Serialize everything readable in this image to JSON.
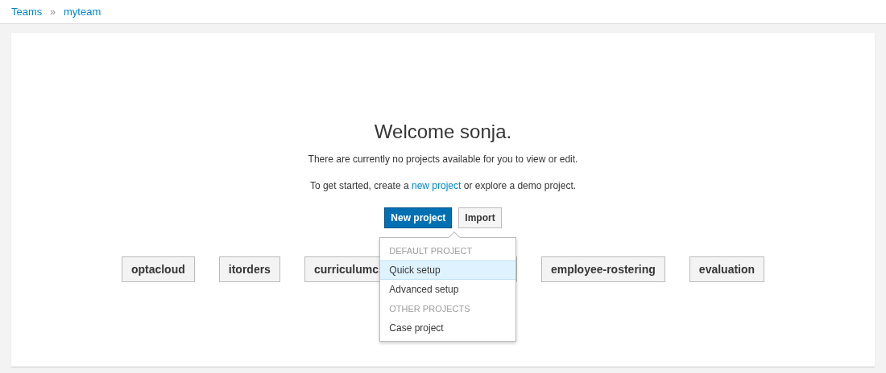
{
  "breadcrumb": [
    {
      "label": "Teams"
    },
    {
      "label": "myteam"
    }
  ],
  "breadcrumb_separator": "»",
  "welcome": {
    "title": "Welcome sonja.",
    "message": "There are currently no projects available for you to view or edit.",
    "hint_before": "To get started, create a",
    "hint_link": "new project",
    "hint_after": "or explore a demo project."
  },
  "buttons": [
    {
      "label": "New project",
      "kind": "primary"
    },
    {
      "label": "Import",
      "kind": "default"
    }
  ],
  "menu": [
    {
      "kind": "header",
      "label": "DEFAULT PROJECT"
    },
    {
      "kind": "item",
      "label": "Quick setup",
      "selected": true
    },
    {
      "kind": "item",
      "label": "Advanced setup",
      "selected": false
    },
    {
      "kind": "header",
      "label": "OTHER PROJECTS"
    },
    {
      "kind": "item",
      "label": "Case project",
      "selected": false
    }
  ],
  "demo_projects": [
    {
      "label": "optacloud",
      "covered": false
    },
    {
      "label": "itorders",
      "covered": false
    },
    {
      "label": "curriculumc",
      "covered": true
    },
    {
      "label": "employee-rostering",
      "covered": false
    },
    {
      "label": "evaluation",
      "covered": false
    }
  ]
}
